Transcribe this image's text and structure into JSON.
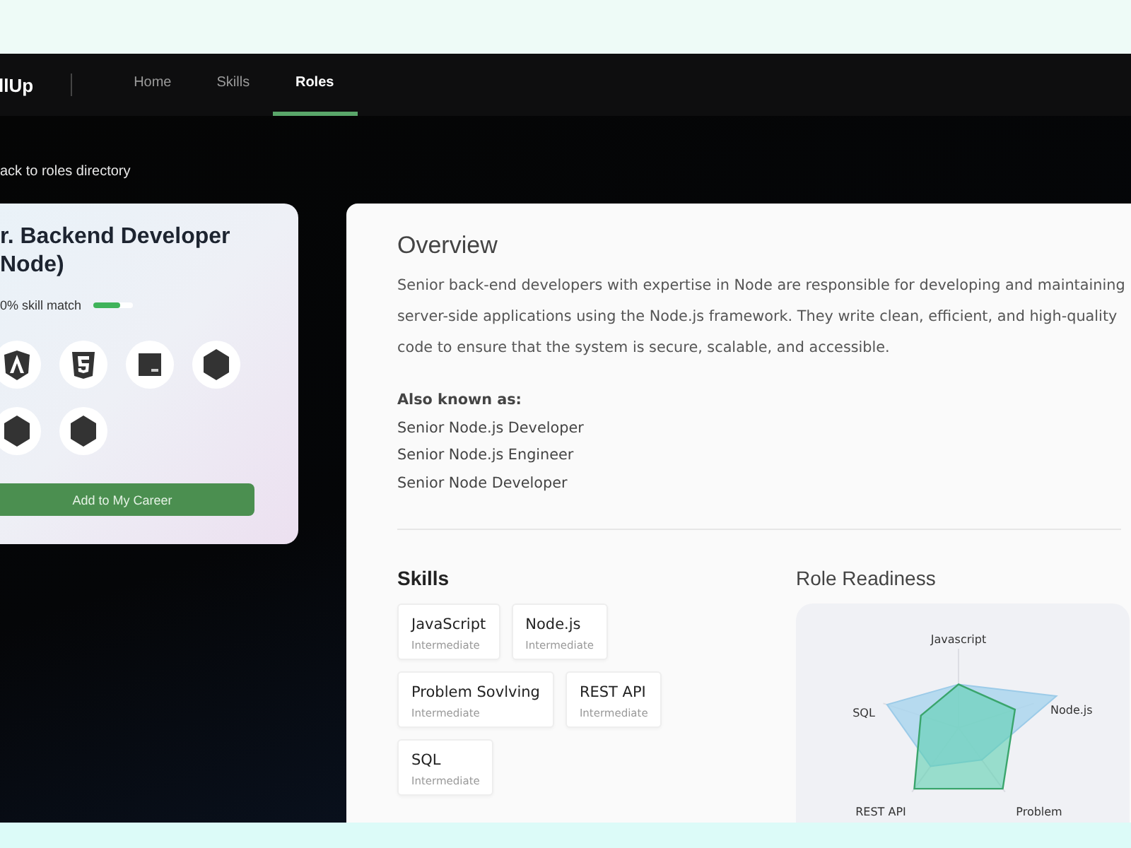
{
  "nav": {
    "brand": "llUp",
    "tabs": [
      {
        "label": "Home",
        "selected": false
      },
      {
        "label": "Skills",
        "selected": false
      },
      {
        "label": "Roles",
        "selected": true
      }
    ]
  },
  "back_link": "ack to roles directory",
  "role_card": {
    "title": "r. Backend Developer Node)",
    "match": "0% skill match",
    "level": 0.7,
    "icons": [
      {
        "kind": "angular"
      },
      {
        "kind": "html5"
      },
      {
        "kind": "js"
      },
      {
        "kind": "hexagon"
      },
      {
        "kind": "hexagon"
      },
      {
        "kind": "hexagon"
      }
    ],
    "button": "Add to My Career"
  },
  "overview": {
    "title": "Overview",
    "text": "Senior back-end developers with expertise in Node are responsible for developing and maintaining server-side applications using the Node.js framework. They write clean, efficient, and high-quality code to ensure that the system is secure, scalable, and accessible.",
    "aka_label": "Also known as:",
    "aka": [
      "Senior Node.js Developer",
      "Senior Node.js Engineer",
      "Senior Node Developer"
    ]
  },
  "skills": {
    "title": "Skills",
    "items": [
      {
        "name": "JavaScript",
        "level": "Intermediate"
      },
      {
        "name": "Node.js",
        "level": "Intermediate"
      },
      {
        "name": "Problem Sovlving",
        "level": "Intermediate"
      },
      {
        "name": "REST API",
        "level": "Intermediate"
      },
      {
        "name": "SQL",
        "level": "Intermediate"
      }
    ]
  },
  "readiness": {
    "title": "Role Readiness",
    "axes": [
      "Javascript",
      "Node.js",
      "Problem",
      "REST API",
      "SQL"
    ]
  }
}
